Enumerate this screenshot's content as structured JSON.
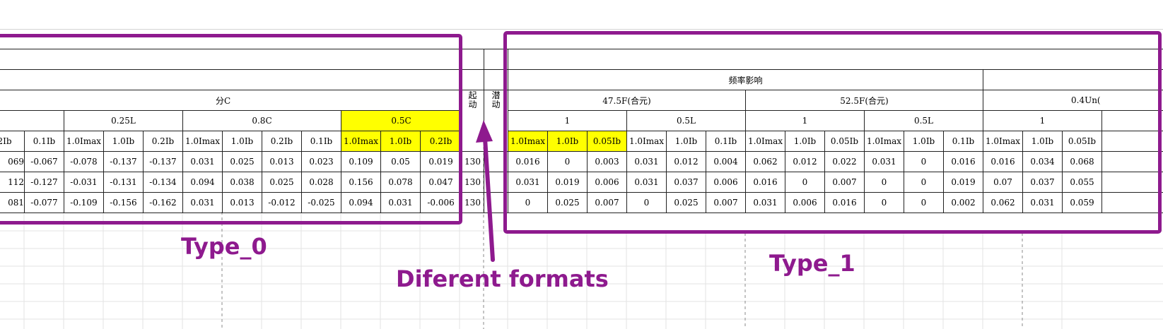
{
  "left_table": {
    "group_title": "分C",
    "subgroups": [
      "0.25L",
      "0.8C",
      "0.5C"
    ],
    "col_headers": [
      "2Ib",
      "0.1Ib",
      "1.0Imax",
      "1.0Ib",
      "0.2Ib",
      "1.0Imax",
      "1.0Ib",
      "0.2Ib",
      "0.1Ib",
      "1.0Imax",
      "1.0Ib",
      "0.2Ib"
    ],
    "rows": [
      [
        "069",
        "-0.067",
        "-0.078",
        "-0.137",
        "-0.137",
        "0.031",
        "0.025",
        "0.013",
        "0.023",
        "0.109",
        "0.05",
        "0.019"
      ],
      [
        "112",
        "-0.127",
        "-0.031",
        "-0.131",
        "-0.134",
        "0.094",
        "0.038",
        "0.025",
        "0.028",
        "0.156",
        "0.078",
        "0.047"
      ],
      [
        "081",
        "-0.077",
        "-0.109",
        "-0.156",
        "-0.162",
        "0.031",
        "0.013",
        "-0.012",
        "-0.025",
        "0.094",
        "0.031",
        "-0.006"
      ]
    ]
  },
  "mid_columns": {
    "start_label": "起动",
    "creep_label": "潜动",
    "start_values": [
      "130",
      "130",
      "130"
    ]
  },
  "right_table": {
    "title": "频率影响",
    "freq_groups": [
      "47.5F(合元)",
      "52.5F(合元)",
      "0.4Un("
    ],
    "pf_groups": [
      "1",
      "0.5L",
      "1",
      "0.5L",
      "1"
    ],
    "col_headers": [
      "1.0Imax",
      "1.0Ib",
      "0.05Ib",
      "1.0Imax",
      "1.0Ib",
      "0.1Ib",
      "1.0Imax",
      "1.0Ib",
      "0.05Ib",
      "1.0Imax",
      "1.0Ib",
      "0.1Ib",
      "1.0Imax",
      "1.0Ib",
      "0.05Ib"
    ],
    "rows": [
      [
        "0.016",
        "0",
        "0.003",
        "0.031",
        "0.012",
        "0.004",
        "0.062",
        "0.012",
        "0.022",
        "0.031",
        "0",
        "0.016",
        "0.016",
        "0.034",
        "0.068"
      ],
      [
        "0.031",
        "0.019",
        "0.006",
        "0.031",
        "0.037",
        "0.006",
        "0.016",
        "0",
        "0.007",
        "0",
        "0",
        "0.019",
        "0.07",
        "0.037",
        "0.055"
      ],
      [
        "0",
        "0.025",
        "0.007",
        "0",
        "0.025",
        "0.007",
        "0.031",
        "0.006",
        "0.016",
        "0",
        "0",
        "0.002",
        "0.062",
        "0.031",
        "0.059"
      ]
    ]
  },
  "annotations": {
    "type0_label": "Type_0",
    "type1_label": "Type_1",
    "formats_label": "Diferent formats",
    "color": "#8e1a8e",
    "highlight_color": "#ffff00"
  }
}
